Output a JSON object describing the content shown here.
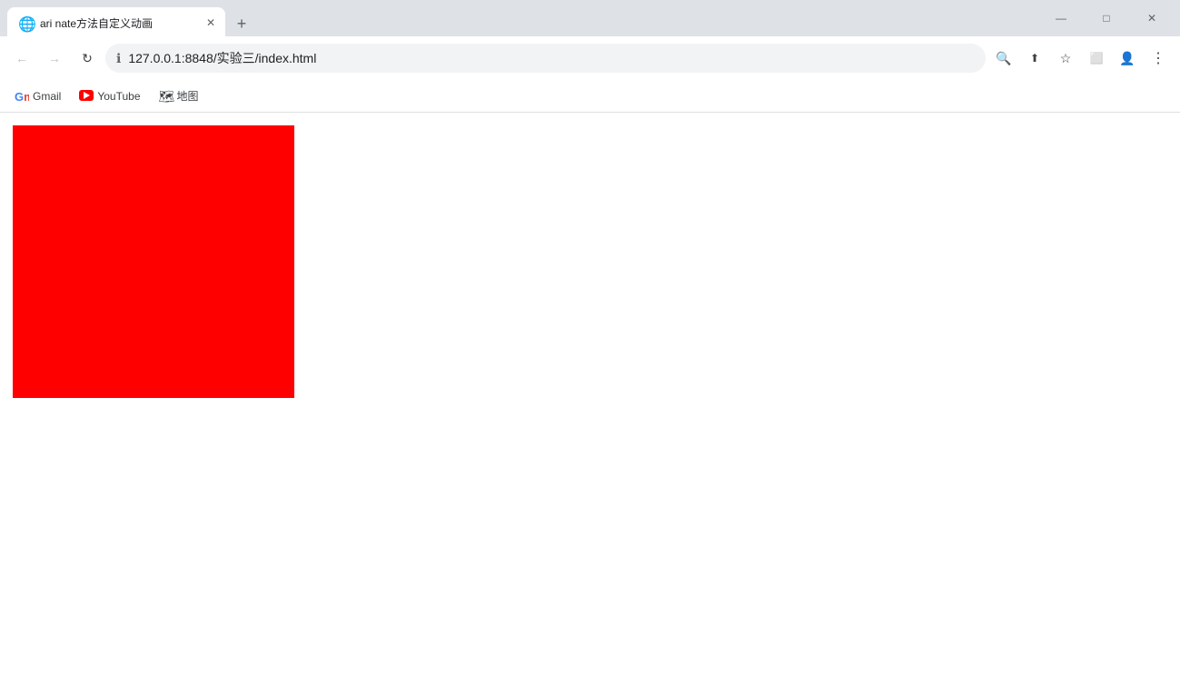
{
  "browser": {
    "tab": {
      "title": "ari nate方法自定义动画",
      "favicon": "🌐"
    },
    "new_tab_label": "+",
    "window_controls": {
      "minimize": "—",
      "maximize": "□",
      "close": "✕"
    }
  },
  "navbar": {
    "back": "←",
    "forward": "→",
    "reload": "↻",
    "url": "127.0.0.1:8848/实验三/index.html",
    "security_icon": "ℹ",
    "zoom_icon": "🔍",
    "share_icon": "⬆",
    "bookmark_icon": "☆",
    "split_icon": "⬜",
    "profile_icon": "👤",
    "more_icon": "⋮"
  },
  "bookmarks": [
    {
      "id": "gmail",
      "label": "Gmail",
      "icon": "gmail"
    },
    {
      "id": "youtube",
      "label": "YouTube",
      "icon": "youtube"
    },
    {
      "id": "maps",
      "label": "地图",
      "icon": "maps"
    }
  ],
  "page": {
    "box_color": "#ff0000"
  }
}
